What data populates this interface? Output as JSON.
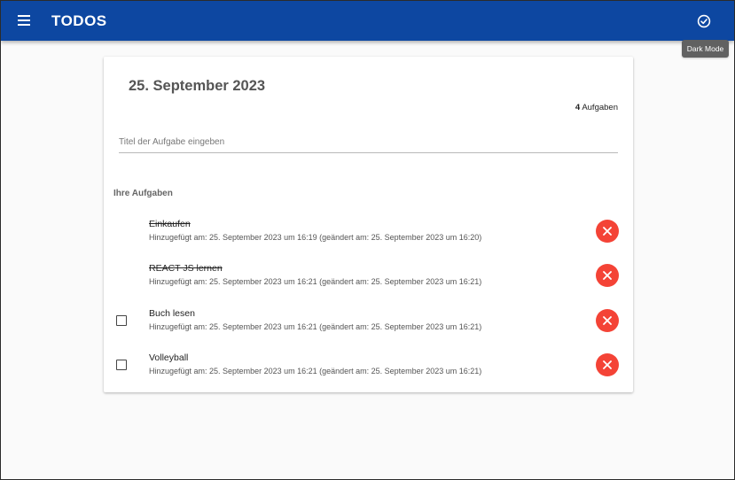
{
  "app": {
    "title": "TODOS",
    "tooltip": "Dark Mode"
  },
  "card": {
    "date": "25. September 2023",
    "count_number": "4",
    "count_label": "Aufgaben",
    "input_placeholder": "Titel der Aufgabe eingeben",
    "input_value": "",
    "section_title": "Ihre Aufgaben"
  },
  "tasks": [
    {
      "title": "Einkaufen",
      "done": true,
      "meta": "Hinzugefügt am: 25. September 2023 um 16:19 (geändert am: 25. September 2023 um 16:20)"
    },
    {
      "title": "REACT JS lernen",
      "done": true,
      "meta": "Hinzugefügt am: 25. September 2023 um 16:21 (geändert am: 25. September 2023 um 16:21)"
    },
    {
      "title": "Buch lesen",
      "done": false,
      "meta": "Hinzugefügt am: 25. September 2023 um 16:21 (geändert am: 25. September 2023 um 16:21)"
    },
    {
      "title": "Volleyball",
      "done": false,
      "meta": "Hinzugefügt am: 25. September 2023 um 16:21 (geändert am: 25. September 2023 um 16:21)"
    }
  ],
  "icons": {
    "menu": "menu-icon",
    "dark_mode": "check-circle-icon",
    "delete": "close-icon",
    "checkbox": "checkbox-outline-icon"
  },
  "colors": {
    "appbar": "#0d47a1",
    "delete": "#f44336",
    "tooltip": "#616161",
    "background": "#fafafa"
  }
}
